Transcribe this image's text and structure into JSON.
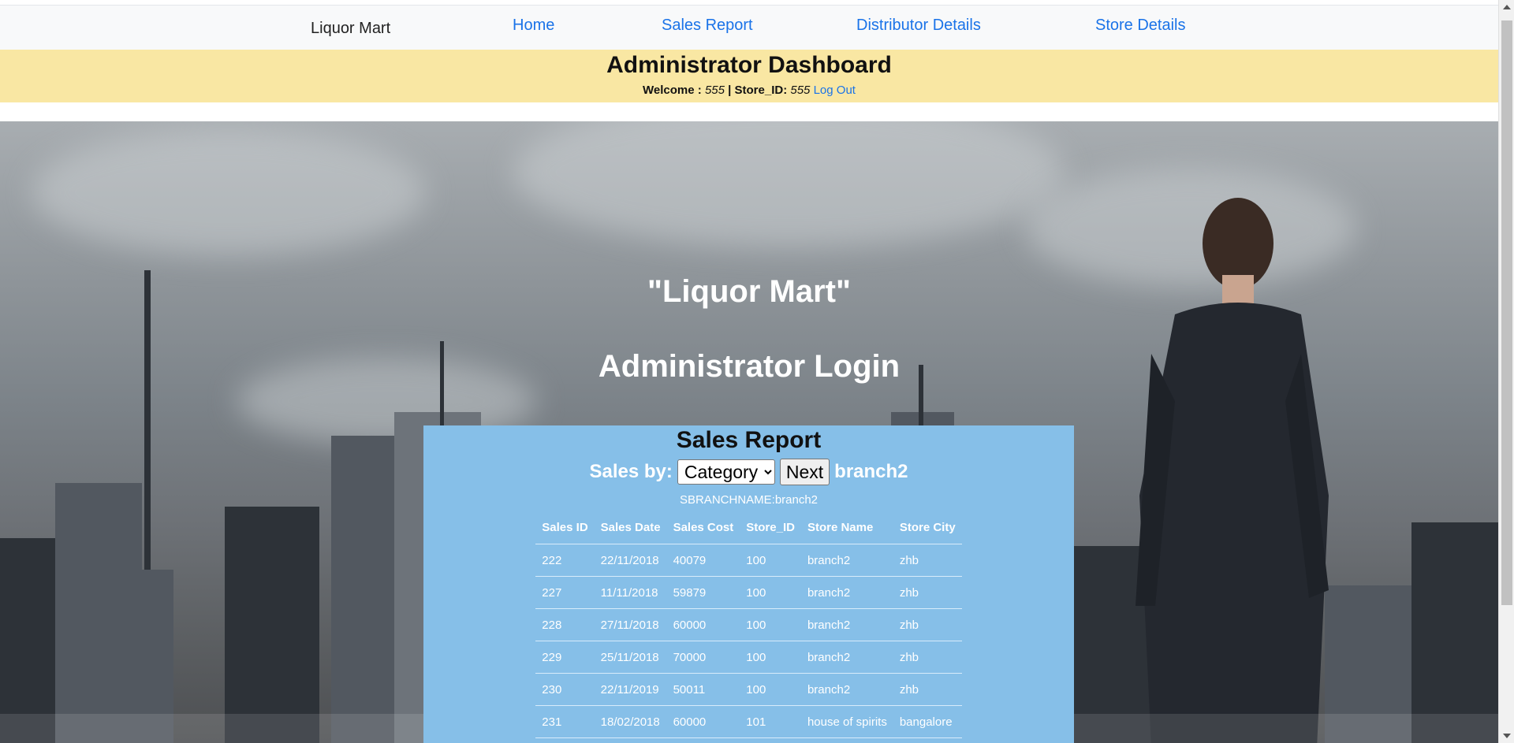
{
  "navbar": {
    "brand": "Liquor Mart",
    "links": [
      "Home",
      "Sales Report",
      "Distributor Details",
      "Store Details"
    ]
  },
  "dashboard": {
    "title": "Administrator Dashboard",
    "welcome_prefix": "Welcome : ",
    "user": "555",
    "separator": " | Store_ID: ",
    "store_id": "555",
    "logout": "Log Out"
  },
  "hero": {
    "title": "\"Liquor Mart\"",
    "subtitle": "Administrator Login"
  },
  "sales_report": {
    "title": "Sales Report",
    "sales_by_label": "Sales by:",
    "select_value": "Category",
    "next_button": "Next",
    "branch": "branch2",
    "branch_line": "SBRANCHNAME:branch2",
    "columns": [
      "Sales ID",
      "Sales Date",
      "Sales Cost",
      "Store_ID",
      "Store Name",
      "Store City"
    ],
    "rows": [
      [
        "222",
        "22/11/2018",
        "40079",
        "100",
        "branch2",
        "zhb"
      ],
      [
        "227",
        "11/11/2018",
        "59879",
        "100",
        "branch2",
        "zhb"
      ],
      [
        "228",
        "27/11/2018",
        "60000",
        "100",
        "branch2",
        "zhb"
      ],
      [
        "229",
        "25/11/2018",
        "70000",
        "100",
        "branch2",
        "zhb"
      ],
      [
        "230",
        "22/11/2019",
        "50011",
        "100",
        "branch2",
        "zhb"
      ],
      [
        "231",
        "18/02/2018",
        "60000",
        "101",
        "house of spirits",
        "bangalore"
      ]
    ]
  },
  "colors": {
    "nav_link": "#1a73e8",
    "dashboard_bg": "#f9e7a3",
    "panel_bg": "#86bfe8"
  }
}
